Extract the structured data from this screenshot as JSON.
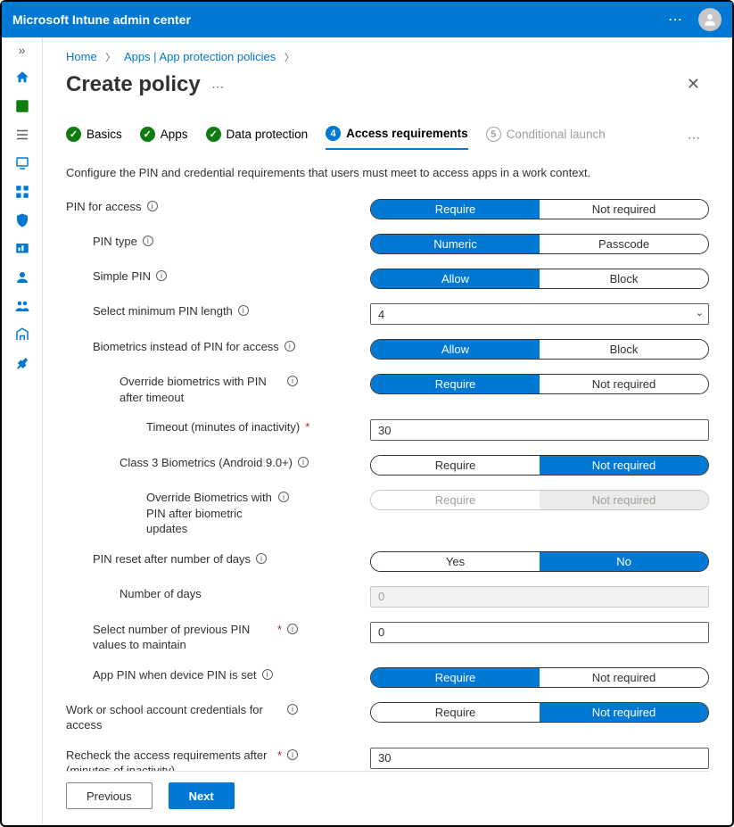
{
  "brand": "Microsoft Intune admin center",
  "breadcrumbs": {
    "home": "Home",
    "apps": "Apps | App protection policies"
  },
  "page_title": "Create policy",
  "steps": {
    "basics": "Basics",
    "apps": "Apps",
    "data_protection": "Data protection",
    "access": "Access requirements",
    "conditional": "Conditional launch",
    "active_num": "4",
    "pending_num": "5"
  },
  "intro": "Configure the PIN and credential requirements that users must meet to access apps in a work context.",
  "labels": {
    "pin_access": "PIN for access",
    "pin_type": "PIN type",
    "simple_pin": "Simple PIN",
    "min_len": "Select minimum PIN length",
    "biometrics": "Biometrics instead of PIN for access",
    "override_bio_timeout": "Override biometrics with PIN after timeout",
    "timeout": "Timeout (minutes of inactivity)",
    "class3": "Class 3 Biometrics (Android 9.0+)",
    "override_bio_updates": "Override Biometrics with PIN after biometric updates",
    "pin_reset": "PIN reset after number of days",
    "num_days": "Number of days",
    "prev_pins": "Select number of previous PIN values to maintain",
    "app_pin_device": "App PIN when device PIN is set",
    "work_creds": "Work or school account credentials for access",
    "recheck": "Recheck the access requirements after (minutes of inactivity)"
  },
  "opts": {
    "require": "Require",
    "not_required": "Not required",
    "numeric": "Numeric",
    "passcode": "Passcode",
    "allow": "Allow",
    "block": "Block",
    "yes": "Yes",
    "no": "No"
  },
  "values": {
    "min_len": "4",
    "timeout": "30",
    "num_days": "0",
    "prev_pins": "0",
    "recheck": "30"
  },
  "nav": {
    "home": "home-icon",
    "dashboard": "dashboard-icon",
    "all": "all-services-icon",
    "devices": "devices-icon",
    "apps": "apps-icon",
    "security": "security-icon",
    "reports": "reports-icon",
    "users": "users-icon",
    "groups": "groups-icon",
    "tenant": "tenant-icon",
    "troubleshoot": "troubleshoot-icon"
  },
  "footer": {
    "prev": "Previous",
    "next": "Next"
  }
}
